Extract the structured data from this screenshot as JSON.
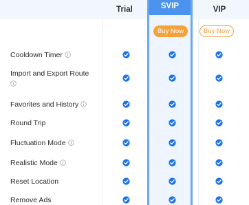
{
  "plans": {
    "trial": "Trial",
    "svip": "SVIP",
    "vip": "VIP"
  },
  "buttons": {
    "svip_buy": "Buy Now",
    "vip_buy": "Buy Now"
  },
  "features": [
    {
      "line1": "Cooldown Timer",
      "line2": "",
      "info": true
    },
    {
      "line1": "Import and Export Route",
      "line2": "",
      "info": true
    },
    {
      "line1": "Favorites and History",
      "line2": "",
      "info": true
    },
    {
      "line1": "Round Trip",
      "line2": "",
      "info": false
    },
    {
      "line1": "Fluctuation Mode",
      "line2": "",
      "info": true
    },
    {
      "line1": "Realistic Mode",
      "line2": "",
      "info": true
    },
    {
      "line1": "Reset Location",
      "line2": "",
      "info": false
    },
    {
      "line1": "Remove Ads",
      "line2": "",
      "info": false
    }
  ],
  "colors": {
    "accent": "#4b93ee",
    "check": "#1a73e8",
    "buy": "#f5a23b"
  },
  "icons": {
    "check": "check-circle-icon",
    "info": "info-icon"
  }
}
